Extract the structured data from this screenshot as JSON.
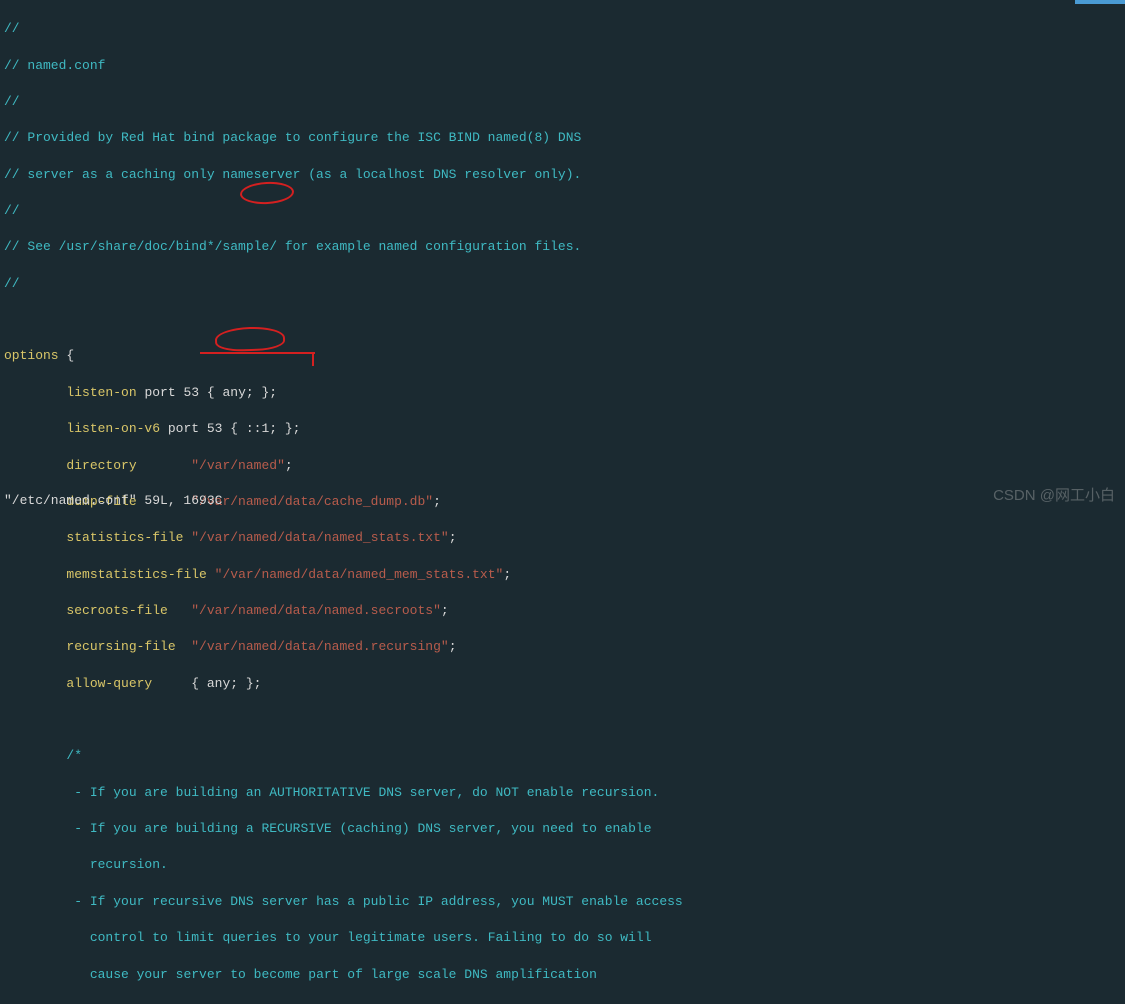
{
  "top_bar": "",
  "lines": {
    "l1": "//",
    "l2": "// named.conf",
    "l3": "//",
    "l4": "// Provided by Red Hat bind package to configure the ISC BIND named(8) DNS",
    "l5": "// server as a caching only nameserver (as a localhost DNS resolver only).",
    "l6": "//",
    "l7": "// See /usr/share/doc/bind*/sample/ for example named configuration files.",
    "l8": "//"
  },
  "options": {
    "keyword": "options",
    "brace_open": " {",
    "listen_on_key": "listen-on",
    "listen_on_rest": " port 53 { ",
    "listen_on_any": "any;",
    "listen_on_end": " };",
    "listen_on_v6_key": "listen-on-v6",
    "listen_on_v6_rest": " port 53 { ::1; };",
    "directory_key": "directory",
    "directory_val": "\"/var/named\"",
    "directory_end": ";",
    "dump_file_key": "dump-file",
    "dump_file_val": "\"/var/named/data/cache_dump.db\"",
    "dump_file_end": ";",
    "stats_key": "statistics-file",
    "stats_val": "\"/var/named/data/named_stats.txt\"",
    "stats_end": ";",
    "memstats_key": "memstatistics-file",
    "memstats_val": "\"/var/named/data/named_mem_stats.txt\"",
    "memstats_end": ";",
    "secroots_key": "secroots-file",
    "secroots_val": "\"/var/named/data/named.secroots\"",
    "secroots_end": ";",
    "recursing_key": "recursing-file",
    "recursing_val": "\"/var/named/data/named.recursing\"",
    "recursing_end": ";",
    "allow_query_key": "allow-query",
    "allow_query_rest": "     { ",
    "allow_query_any": "any;",
    "allow_query_end": " };"
  },
  "block_comment": {
    "open": "/*",
    "c1": " - If you are building an AUTHORITATIVE DNS server, do NOT enable recursion.",
    "c2": " - If you are building a RECURSIVE (caching) DNS server, you need to enable",
    "c3": "   recursion.",
    "c4": " - If your recursive DNS server has a public IP address, you MUST enable access",
    "c5": "   control to limit queries to your legitimate users. Failing to do so will",
    "c6": "   cause your server to become part of large scale DNS amplification"
  },
  "status": "\"/etc/named.conf\" 59L, 1693C",
  "watermark": "CSDN @网工小白",
  "annotations": {
    "circle1": "any-circle-1",
    "circle2": "any-circle-2"
  }
}
